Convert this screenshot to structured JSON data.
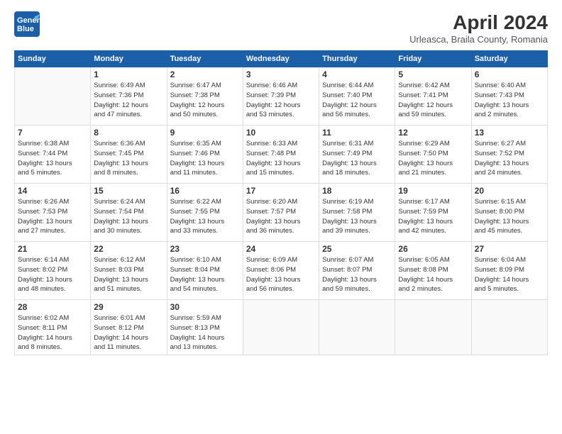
{
  "logo": {
    "line1": "General",
    "line2": "Blue"
  },
  "title": "April 2024",
  "location": "Urleasca, Braila County, Romania",
  "weekdays": [
    "Sunday",
    "Monday",
    "Tuesday",
    "Wednesday",
    "Thursday",
    "Friday",
    "Saturday"
  ],
  "weeks": [
    [
      {
        "day": "",
        "info": ""
      },
      {
        "day": "1",
        "info": "Sunrise: 6:49 AM\nSunset: 7:36 PM\nDaylight: 12 hours\nand 47 minutes."
      },
      {
        "day": "2",
        "info": "Sunrise: 6:47 AM\nSunset: 7:38 PM\nDaylight: 12 hours\nand 50 minutes."
      },
      {
        "day": "3",
        "info": "Sunrise: 6:46 AM\nSunset: 7:39 PM\nDaylight: 12 hours\nand 53 minutes."
      },
      {
        "day": "4",
        "info": "Sunrise: 6:44 AM\nSunset: 7:40 PM\nDaylight: 12 hours\nand 56 minutes."
      },
      {
        "day": "5",
        "info": "Sunrise: 6:42 AM\nSunset: 7:41 PM\nDaylight: 12 hours\nand 59 minutes."
      },
      {
        "day": "6",
        "info": "Sunrise: 6:40 AM\nSunset: 7:43 PM\nDaylight: 13 hours\nand 2 minutes."
      }
    ],
    [
      {
        "day": "7",
        "info": "Sunrise: 6:38 AM\nSunset: 7:44 PM\nDaylight: 13 hours\nand 5 minutes."
      },
      {
        "day": "8",
        "info": "Sunrise: 6:36 AM\nSunset: 7:45 PM\nDaylight: 13 hours\nand 8 minutes."
      },
      {
        "day": "9",
        "info": "Sunrise: 6:35 AM\nSunset: 7:46 PM\nDaylight: 13 hours\nand 11 minutes."
      },
      {
        "day": "10",
        "info": "Sunrise: 6:33 AM\nSunset: 7:48 PM\nDaylight: 13 hours\nand 15 minutes."
      },
      {
        "day": "11",
        "info": "Sunrise: 6:31 AM\nSunset: 7:49 PM\nDaylight: 13 hours\nand 18 minutes."
      },
      {
        "day": "12",
        "info": "Sunrise: 6:29 AM\nSunset: 7:50 PM\nDaylight: 13 hours\nand 21 minutes."
      },
      {
        "day": "13",
        "info": "Sunrise: 6:27 AM\nSunset: 7:52 PM\nDaylight: 13 hours\nand 24 minutes."
      }
    ],
    [
      {
        "day": "14",
        "info": "Sunrise: 6:26 AM\nSunset: 7:53 PM\nDaylight: 13 hours\nand 27 minutes."
      },
      {
        "day": "15",
        "info": "Sunrise: 6:24 AM\nSunset: 7:54 PM\nDaylight: 13 hours\nand 30 minutes."
      },
      {
        "day": "16",
        "info": "Sunrise: 6:22 AM\nSunset: 7:55 PM\nDaylight: 13 hours\nand 33 minutes."
      },
      {
        "day": "17",
        "info": "Sunrise: 6:20 AM\nSunset: 7:57 PM\nDaylight: 13 hours\nand 36 minutes."
      },
      {
        "day": "18",
        "info": "Sunrise: 6:19 AM\nSunset: 7:58 PM\nDaylight: 13 hours\nand 39 minutes."
      },
      {
        "day": "19",
        "info": "Sunrise: 6:17 AM\nSunset: 7:59 PM\nDaylight: 13 hours\nand 42 minutes."
      },
      {
        "day": "20",
        "info": "Sunrise: 6:15 AM\nSunset: 8:00 PM\nDaylight: 13 hours\nand 45 minutes."
      }
    ],
    [
      {
        "day": "21",
        "info": "Sunrise: 6:14 AM\nSunset: 8:02 PM\nDaylight: 13 hours\nand 48 minutes."
      },
      {
        "day": "22",
        "info": "Sunrise: 6:12 AM\nSunset: 8:03 PM\nDaylight: 13 hours\nand 51 minutes."
      },
      {
        "day": "23",
        "info": "Sunrise: 6:10 AM\nSunset: 8:04 PM\nDaylight: 13 hours\nand 54 minutes."
      },
      {
        "day": "24",
        "info": "Sunrise: 6:09 AM\nSunset: 8:06 PM\nDaylight: 13 hours\nand 56 minutes."
      },
      {
        "day": "25",
        "info": "Sunrise: 6:07 AM\nSunset: 8:07 PM\nDaylight: 13 hours\nand 59 minutes."
      },
      {
        "day": "26",
        "info": "Sunrise: 6:05 AM\nSunset: 8:08 PM\nDaylight: 14 hours\nand 2 minutes."
      },
      {
        "day": "27",
        "info": "Sunrise: 6:04 AM\nSunset: 8:09 PM\nDaylight: 14 hours\nand 5 minutes."
      }
    ],
    [
      {
        "day": "28",
        "info": "Sunrise: 6:02 AM\nSunset: 8:11 PM\nDaylight: 14 hours\nand 8 minutes."
      },
      {
        "day": "29",
        "info": "Sunrise: 6:01 AM\nSunset: 8:12 PM\nDaylight: 14 hours\nand 11 minutes."
      },
      {
        "day": "30",
        "info": "Sunrise: 5:59 AM\nSunset: 8:13 PM\nDaylight: 14 hours\nand 13 minutes."
      },
      {
        "day": "",
        "info": ""
      },
      {
        "day": "",
        "info": ""
      },
      {
        "day": "",
        "info": ""
      },
      {
        "day": "",
        "info": ""
      }
    ]
  ]
}
